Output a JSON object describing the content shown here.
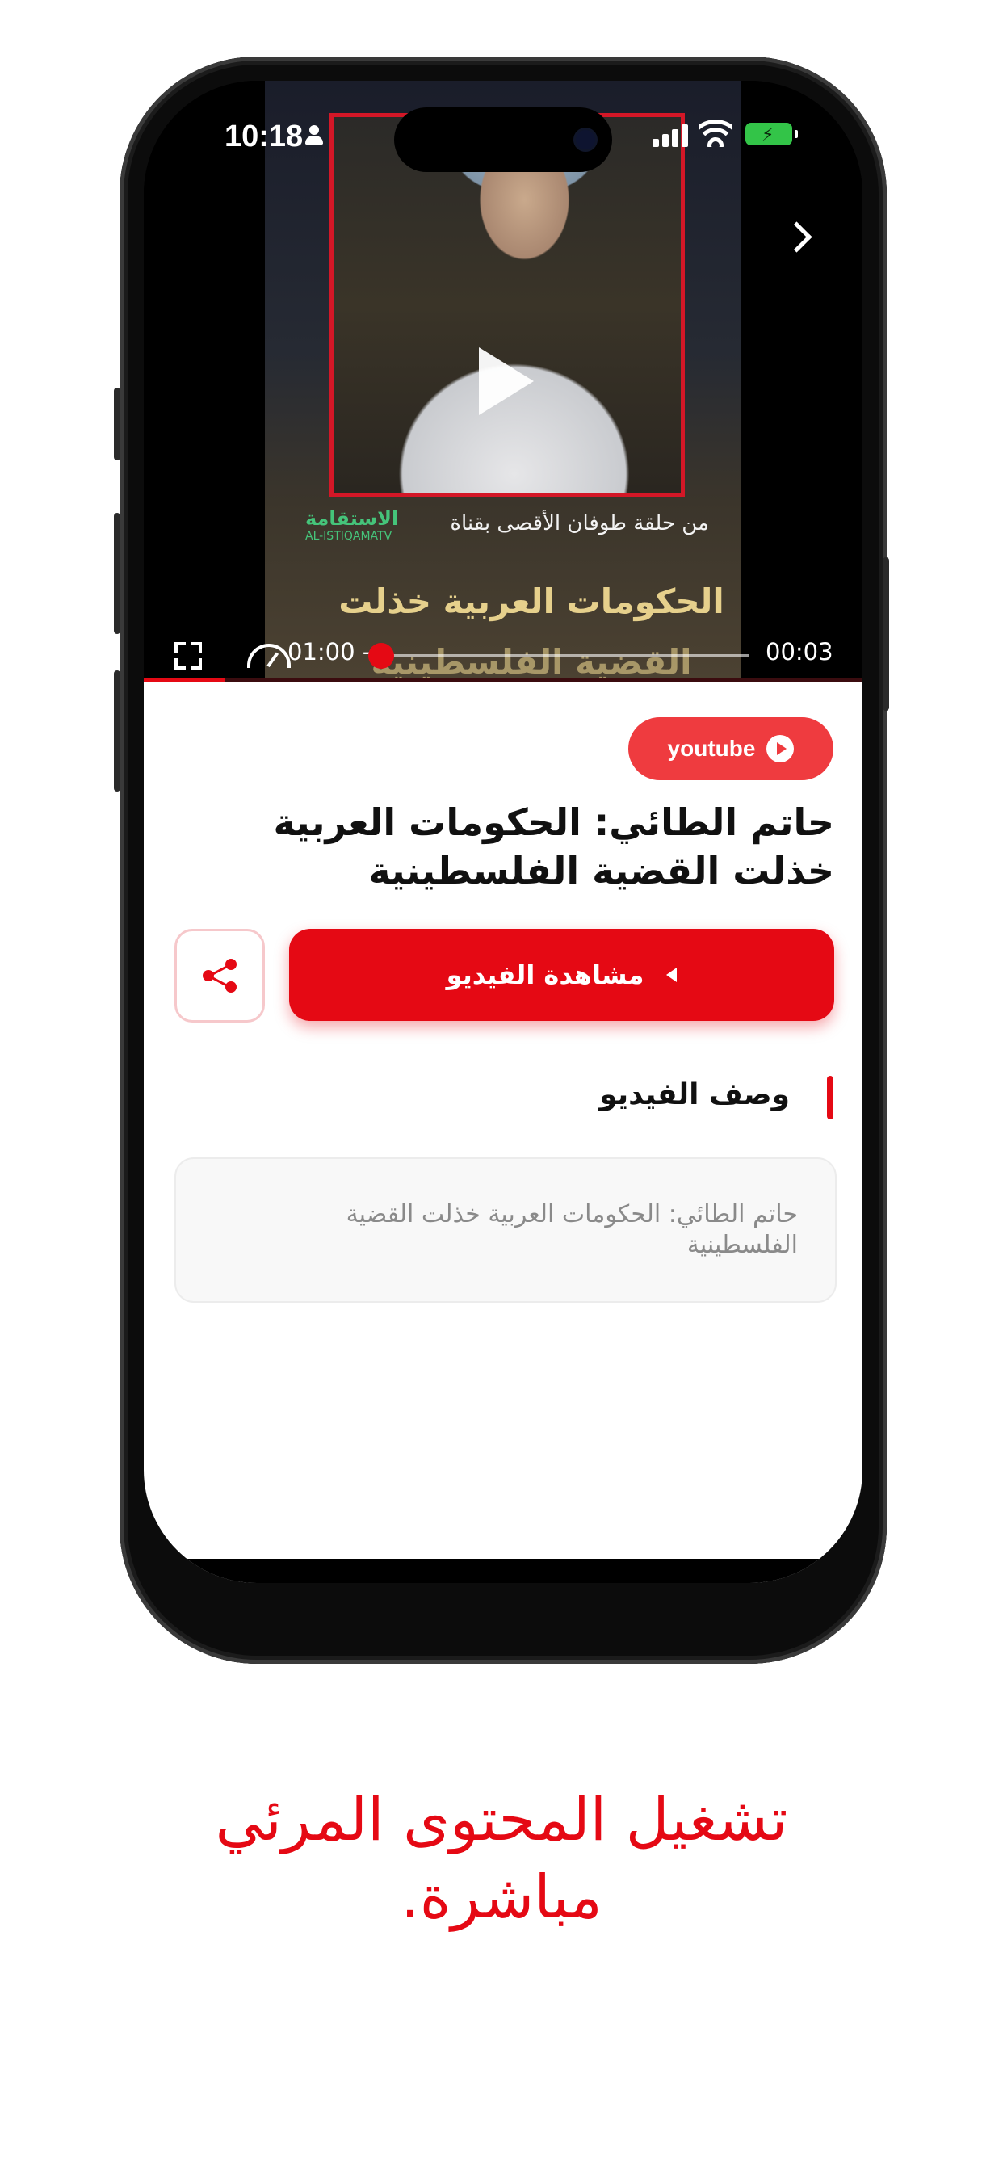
{
  "status_bar": {
    "time": "10:18"
  },
  "video": {
    "overlay_caption": "من حلقة طوفان الأقصى بقناة",
    "channel_logo": "الاستقامة",
    "channel_logo_sub": "AL-ISTIQAMATV",
    "headline_line1": "الحكومات العربية خذلت",
    "headline_line2": "القضية الفلسطينية",
    "time_left": "01:00 -",
    "time_right": "00:03",
    "progress": 0.03
  },
  "badge": {
    "label": "youtube"
  },
  "title": "حاتم الطائي: الحكومات العربية خذلت القضية الفلسطينية",
  "actions": {
    "watch_label": "مشاهدة الفيديو"
  },
  "description": {
    "section_title": "وصف الفيديو",
    "text": "حاتم الطائي: الحكومات العربية خذلت القضية الفلسطينية"
  },
  "promo": {
    "line1": "تشغيل المحتوى المرئي",
    "line2": "مباشرة."
  },
  "colors": {
    "accent": "#e50914",
    "badge": "#ef3b3f"
  }
}
